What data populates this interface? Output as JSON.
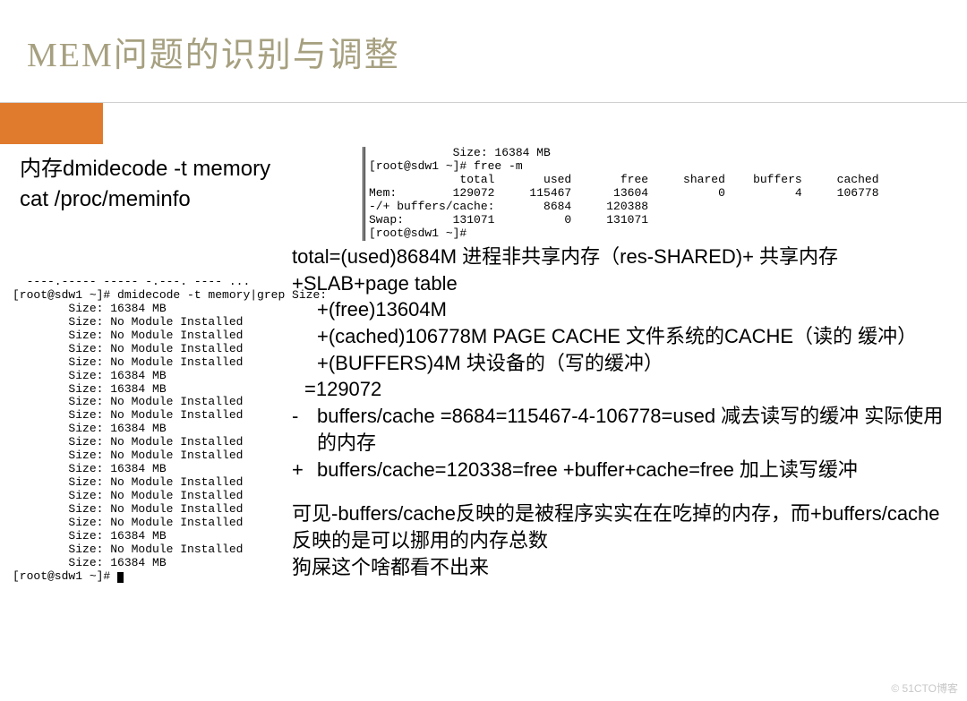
{
  "slide": {
    "title": "MEM问题的识别与调整"
  },
  "intro": {
    "line1": "内存dmidecode -t memory",
    "line2": "cat /proc/meminfo"
  },
  "free_output": {
    "banner": "            Size: 16384 MB",
    "prompt1": "[root@sdw1 ~]# free -m",
    "header": "             total       used       free     shared    buffers     cached",
    "mem": "Mem:        129072     115467      13604          0          4     106778",
    "buff": "-/+ buffers/cache:       8684     120388",
    "swap": "Swap:       131071          0     131071",
    "prompt2": "[root@sdw1 ~]#"
  },
  "dmi_output": {
    "top": "  ----.----- ----- -.---. ---- ...",
    "cmd": "[root@sdw1 ~]# dmidecode -t memory|grep Size:",
    "lines": [
      "        Size: 16384 MB",
      "        Size: No Module Installed",
      "        Size: No Module Installed",
      "        Size: No Module Installed",
      "        Size: No Module Installed",
      "        Size: 16384 MB",
      "        Size: 16384 MB",
      "        Size: No Module Installed",
      "        Size: No Module Installed",
      "        Size: 16384 MB",
      "        Size: No Module Installed",
      "        Size: No Module Installed",
      "        Size: 16384 MB",
      "        Size: No Module Installed",
      "        Size: No Module Installed",
      "        Size: No Module Installed",
      "        Size: No Module Installed",
      "        Size: 16384 MB",
      "        Size: No Module Installed",
      "        Size: 16384 MB"
    ],
    "prompt": "[root@sdw1 ~]# "
  },
  "explain": {
    "p1": "total=(used)8684M 进程非共享内存（res-SHARED)+ 共享内存+SLAB+page table",
    "p2": "+(free)13604M",
    "p3": "+(cached)106778M PAGE CACHE 文件系统的CACHE（读的 缓冲）",
    "p4": "+(BUFFERS)4M 块设备的（写的缓冲）",
    "p5": "=129072",
    "minus_label": "-",
    "minus_body": "buffers/cache =8684=115467-4-106778=used 减去读写的缓冲 实际使用的内存",
    "plus_label": "+",
    "plus_body": "buffers/cache=120338=free +buffer+cache=free 加上读写缓冲",
    "c1": "可见-buffers/cache反映的是被程序实实在在吃掉的内存，而+buffers/cache反映的是可以挪用的内存总数",
    "c2": "狗屎这个啥都看不出来"
  },
  "watermark": "© 51CTO博客"
}
